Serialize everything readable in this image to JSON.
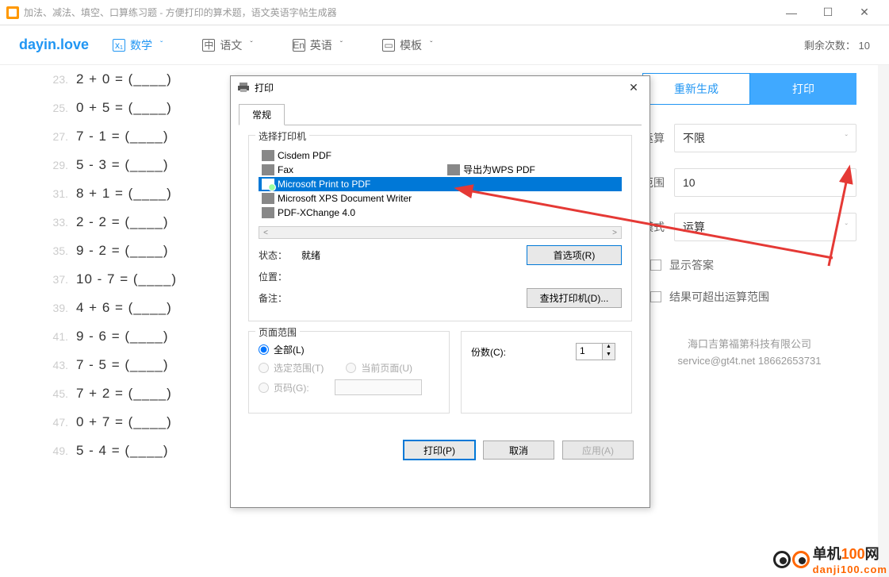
{
  "window": {
    "title": "加法、减法、填空、口算练习题 - 方便打印的算术题，语文英语字帖生成器",
    "min": "—",
    "max": "☐",
    "close": "✕"
  },
  "nav": {
    "logo": "dayin.love",
    "items": [
      {
        "icon": "x₁",
        "label": "数学"
      },
      {
        "icon": "中",
        "label": "语文"
      },
      {
        "icon": "En",
        "label": "英语"
      },
      {
        "icon": "▭",
        "label": "模板"
      }
    ],
    "remaining_label": "剩余次数：",
    "remaining_count": "10"
  },
  "problems": [
    {
      "num": "23.",
      "text": "2 + 0 = (____)"
    },
    {
      "num": "25.",
      "text": "0 + 5 = (____)"
    },
    {
      "num": "27.",
      "text": "7 - 1 = (____)"
    },
    {
      "num": "29.",
      "text": "5 - 3 = (____)"
    },
    {
      "num": "31.",
      "text": "8 + 1 = (____)"
    },
    {
      "num": "33.",
      "text": "2 - 2 = (____)"
    },
    {
      "num": "35.",
      "text": "9 - 2 = (____)"
    },
    {
      "num": "37.",
      "text": "10 - 7 = (____)"
    },
    {
      "num": "39.",
      "text": "4 + 6 = (____)"
    },
    {
      "num": "41.",
      "text": "9 - 6 = (____)"
    },
    {
      "num": "43.",
      "text": "7 - 5 = (____)"
    },
    {
      "num": "45.",
      "text": "7 + 2 = (____)"
    },
    {
      "num": "47.",
      "text": "0 + 7 = (____)"
    },
    {
      "num": "49.",
      "text": "5 - 4 = (____)"
    }
  ],
  "sidebar": {
    "regenerate": "重新生成",
    "print": "打印",
    "fields": {
      "op_label": "运算",
      "op_value": "不限",
      "range_label": "范围",
      "range_value": "10",
      "mode_label": "模式",
      "mode_value": "运算"
    },
    "check_answers": "显示答案",
    "check_overflow": "结果可超出运算范围",
    "footer1": "海口吉第福第科技有限公司",
    "footer2": "service@gt4t.net 18662653731"
  },
  "dialog": {
    "title": "打印",
    "tab": "常规",
    "select_printer": "选择打印机",
    "printers": [
      {
        "name": "Cisdem PDF",
        "selected": false
      },
      {
        "name": "Fax",
        "selected": false
      },
      {
        "name": "Microsoft Print to PDF",
        "selected": true
      },
      {
        "name": "Microsoft XPS Document Writer",
        "selected": false
      },
      {
        "name": "PDF-XChange 4.0",
        "selected": false
      }
    ],
    "wps_printer": "导出为WPS PDF",
    "status_label": "状态：",
    "status_value": "就绪",
    "location_label": "位置：",
    "notes_label": "备注：",
    "prefs_btn": "首选项(R)",
    "find_btn": "查找打印机(D)...",
    "range_label": "页面范围",
    "range_all": "全部(L)",
    "range_sel": "选定范围(T)",
    "range_cur": "当前页面(U)",
    "range_pages": "页码(G):",
    "copies_label": "份数(C):",
    "copies_value": "1",
    "btn_print": "打印(P)",
    "btn_cancel": "取消",
    "btn_apply": "应用(A)"
  },
  "watermark": {
    "text1": "单机",
    "text2": "100",
    "text3": "网",
    "domain": "danji100.com"
  }
}
